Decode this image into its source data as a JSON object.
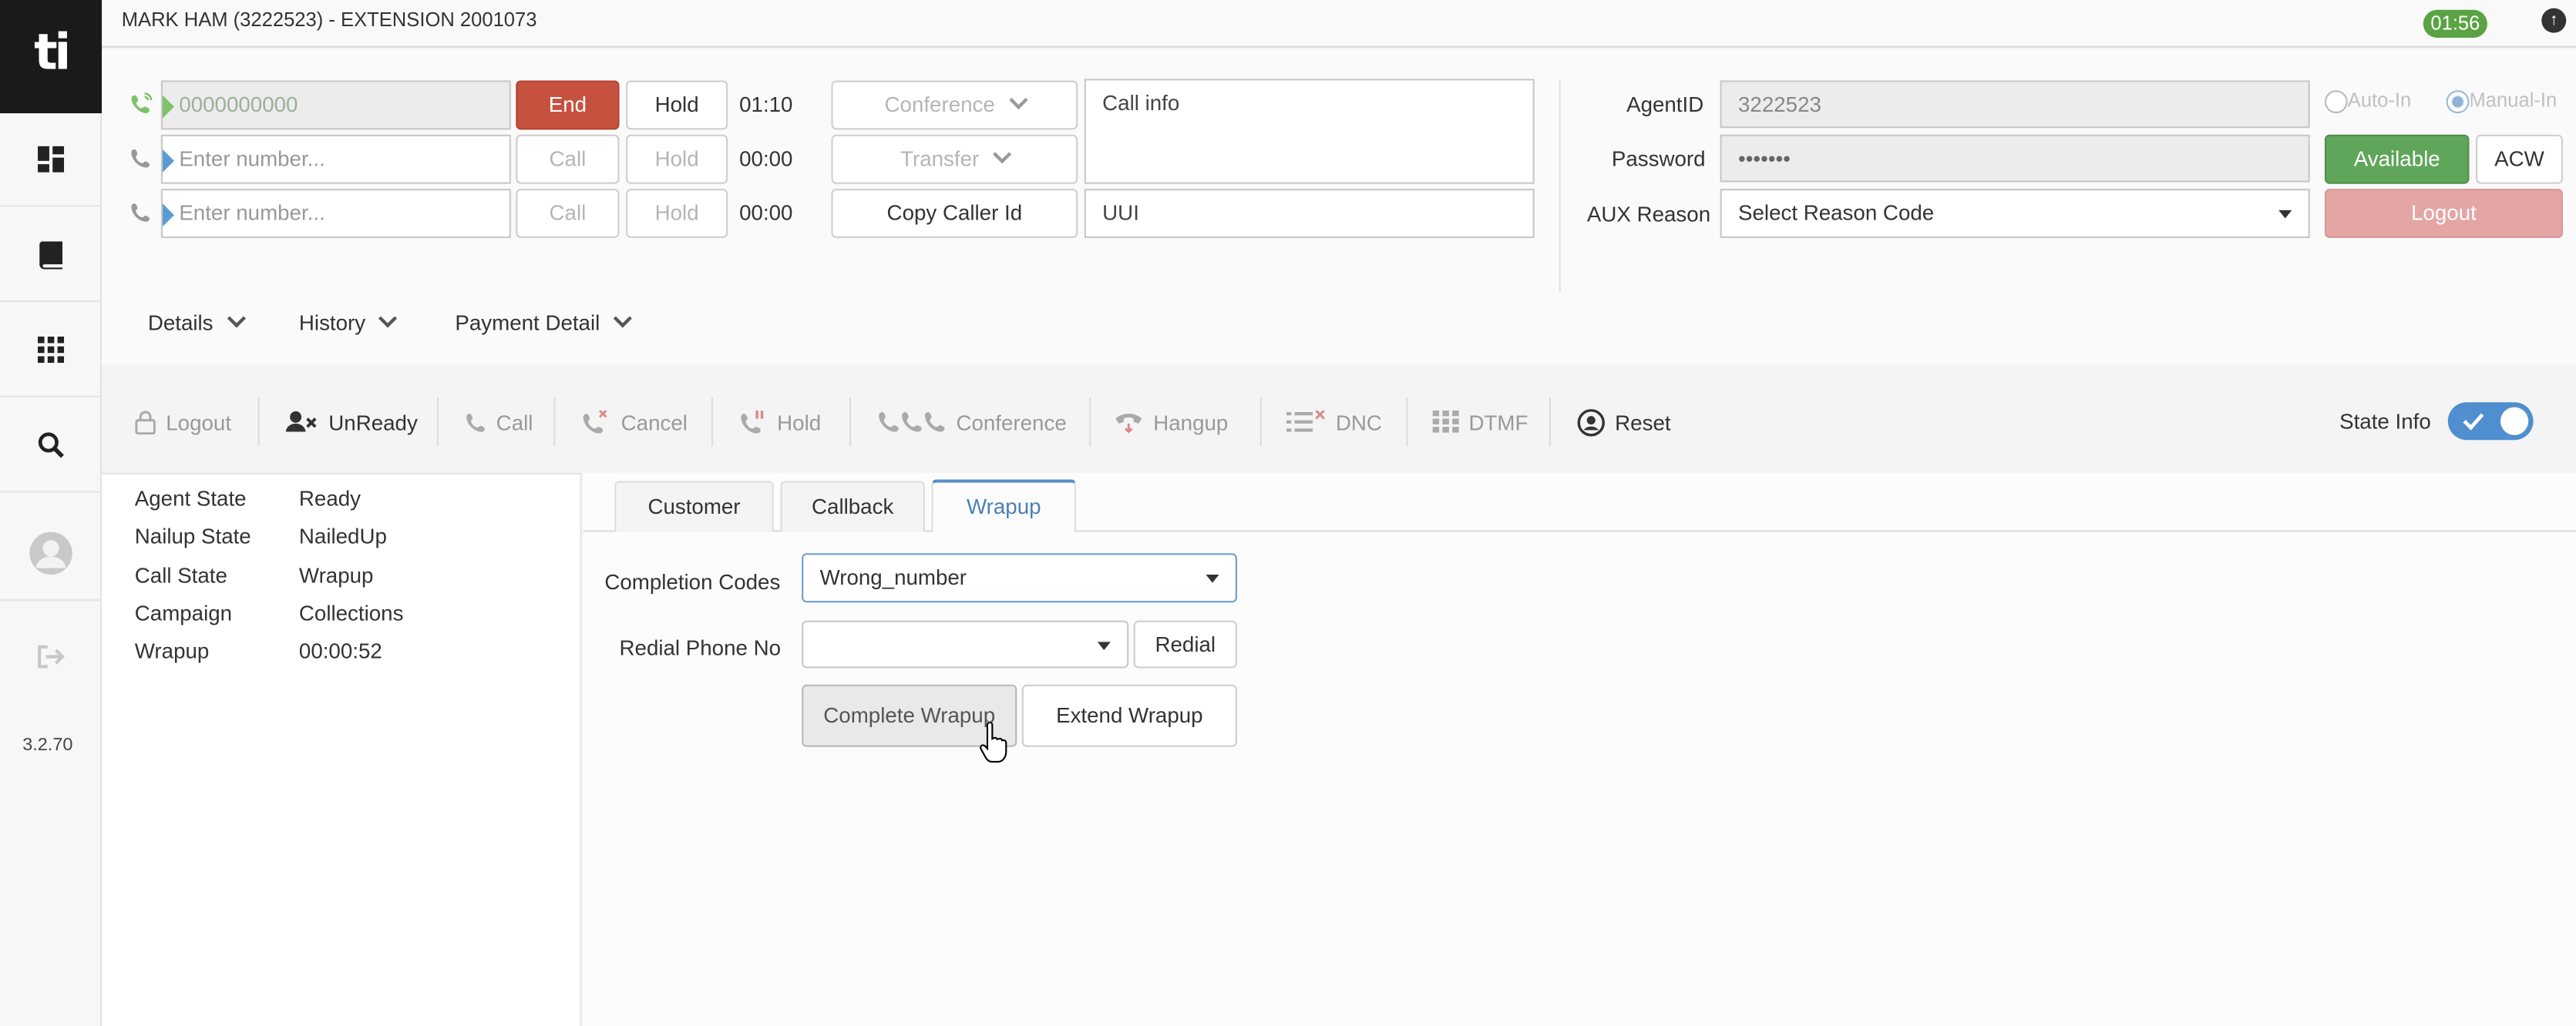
{
  "app": {
    "logo": "ti",
    "version": "3.2.70"
  },
  "header": {
    "title": "MARK HAM (3222523) - EXTENSION 2001073",
    "timer": "01:56"
  },
  "sidebar": {
    "items": [
      {
        "icon": "dashboard-icon"
      },
      {
        "icon": "book-icon"
      },
      {
        "icon": "apps-grid-icon"
      },
      {
        "icon": "search-icon"
      },
      {
        "icon": "user-avatar-icon"
      },
      {
        "icon": "sign-out-icon"
      }
    ]
  },
  "call_lines": [
    {
      "value": "0000000000",
      "placeholder": "",
      "primary": "End",
      "hold": "Hold",
      "time": "01:10"
    },
    {
      "value": "",
      "placeholder": "Enter number...",
      "primary": "Call",
      "hold": "Hold",
      "time": "00:00"
    },
    {
      "value": "",
      "placeholder": "Enter number...",
      "primary": "Call",
      "hold": "Hold",
      "time": "00:00"
    }
  ],
  "call_actions": {
    "conference": "Conference",
    "transfer": "Transfer",
    "copy_caller": "Copy Caller Id"
  },
  "call_info": {
    "placeholder": "Call info",
    "uui_placeholder": "UUI"
  },
  "agent": {
    "id_label": "AgentID",
    "id_value": "3222523",
    "password_label": "Password",
    "password_value": "•••••••",
    "aux_label": "AUX Reason",
    "aux_value": "Select Reason Code",
    "auto_in": "Auto-In",
    "manual_in": "Manual-In",
    "available": "Available",
    "acw": "ACW",
    "logout": "Logout"
  },
  "sections": {
    "details": "Details",
    "history": "History",
    "payment": "Payment Detail"
  },
  "toolbar": {
    "logout": "Logout",
    "unready": "UnReady",
    "call": "Call",
    "cancel": "Cancel",
    "hold": "Hold",
    "conference": "Conference",
    "hangup": "Hangup",
    "dnc": "DNC",
    "dtmf": "DTMF",
    "reset": "Reset",
    "state_info": "State Info"
  },
  "state": [
    {
      "key": "Agent State",
      "value": "Ready"
    },
    {
      "key": "Nailup State",
      "value": "NailedUp"
    },
    {
      "key": "Call State",
      "value": "Wrapup"
    },
    {
      "key": "Campaign",
      "value": "Collections"
    },
    {
      "key": "Wrapup",
      "value": "00:00:52"
    }
  ],
  "tabs": [
    "Customer",
    "Callback",
    "Wrapup"
  ],
  "wrapup": {
    "completion_label": "Completion Codes",
    "completion_value": "Wrong_number",
    "redial_label": "Redial Phone No",
    "redial_value": "",
    "redial_button": "Redial",
    "complete_button": "Complete Wrapup",
    "extend_button": "Extend Wrapup"
  },
  "colors": {
    "end": "#c7513f",
    "available": "#5fa65a",
    "logout": "#e4a5a5",
    "accent": "#4f8fd0",
    "timer": "#5aa344"
  }
}
